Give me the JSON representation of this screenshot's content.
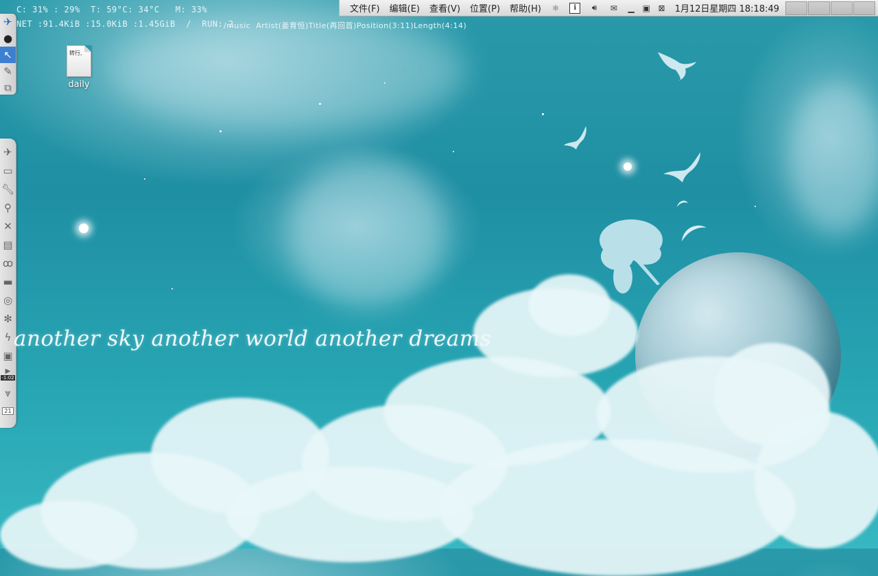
{
  "conky": {
    "line1": "C: 31% : 29%  T: 59°C: 34°C   M: 33%",
    "line2": "NET :91.4KiB :15.0KiB :1.45GiB  /  RUN: 2",
    "music": "/music  Artist(姜育恒)Title(再回首)Position(3:11)Length(4:14)"
  },
  "menubar": {
    "items": [
      "文件(F)",
      "编辑(E)",
      "查看(V)",
      "位置(P)",
      "帮助(H)"
    ]
  },
  "tray": {
    "info": "i",
    "clock": "1月12日星期四 18:18:49"
  },
  "desktop_icon": {
    "label": "daily",
    "preview_text": "转行,"
  },
  "wallpaper_text": "another sky another world another dreams",
  "dock_badges": {
    "timer": "-1:02",
    "calendar": "21"
  },
  "colors": {
    "sky_top": "#2a9aaa",
    "sky_bottom": "#37b7c1",
    "panel": "#e4e4e4"
  }
}
